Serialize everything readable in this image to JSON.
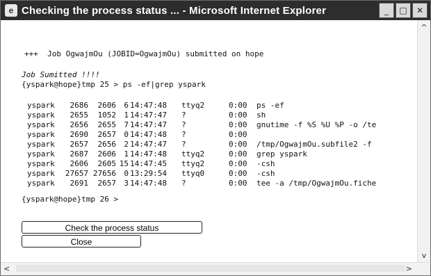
{
  "window": {
    "title": "Checking the process status ... - Microsoft Internet Explorer",
    "minimize": "_",
    "maximize": "□",
    "close": "✕"
  },
  "output": {
    "job_line": "+++  Job OgwajmOu (JOBID=OgwajmOu) submitted on hope",
    "job_submitted": "Job Sumitted !!!!",
    "prompt_ps": "{yspark@hope}tmp 25 > ps -ef|grep yspark",
    "processes": [
      {
        "user": "yspark",
        "pid": "2686",
        "ppid": "2606",
        "c": "6",
        "stime": "14:47:48",
        "tty": "ttyq2",
        "time": "0:00",
        "cmd": "ps -ef"
      },
      {
        "user": "yspark",
        "pid": "2655",
        "ppid": "1052",
        "c": "1",
        "stime": "14:47:47",
        "tty": "?",
        "time": "0:00",
        "cmd": "sh"
      },
      {
        "user": "yspark",
        "pid": "2656",
        "ppid": "2655",
        "c": "7",
        "stime": "14:47:47",
        "tty": "?",
        "time": "0:00",
        "cmd": "gnutime -f %S %U %P -o /te"
      },
      {
        "user": "yspark",
        "pid": "2690",
        "ppid": "2657",
        "c": "0",
        "stime": "14:47:48",
        "tty": "?",
        "time": "0:00",
        "cmd": ""
      },
      {
        "user": "yspark",
        "pid": "2657",
        "ppid": "2656",
        "c": "2",
        "stime": "14:47:47",
        "tty": "?",
        "time": "0:00",
        "cmd": "/tmp/OgwajmOu.subfile2 -f"
      },
      {
        "user": "yspark",
        "pid": "2687",
        "ppid": "2606",
        "c": "1",
        "stime": "14:47:48",
        "tty": "ttyq2",
        "time": "0:00",
        "cmd": "grep yspark"
      },
      {
        "user": "yspark",
        "pid": "2606",
        "ppid": "2605",
        "c": "15",
        "stime": "14:47:45",
        "tty": "ttyq2",
        "time": "0:00",
        "cmd": "-csh"
      },
      {
        "user": "yspark",
        "pid": "27657",
        "ppid": "27656",
        "c": "0",
        "stime": "13:29:54",
        "tty": "ttyq0",
        "time": "0:00",
        "cmd": "-csh"
      },
      {
        "user": "yspark",
        "pid": "2691",
        "ppid": "2657",
        "c": "3",
        "stime": "14:47:48",
        "tty": "?",
        "time": "0:00",
        "cmd": "tee -a /tmp/OgwajmOu.fiche"
      }
    ],
    "prompt_end": "{yspark@hope}tmp 26 >"
  },
  "buttons": {
    "check_status": "Check the process status",
    "close": "Close"
  },
  "scrollbar": {
    "up": "^",
    "down": "v",
    "left": "<",
    "right": ">"
  }
}
